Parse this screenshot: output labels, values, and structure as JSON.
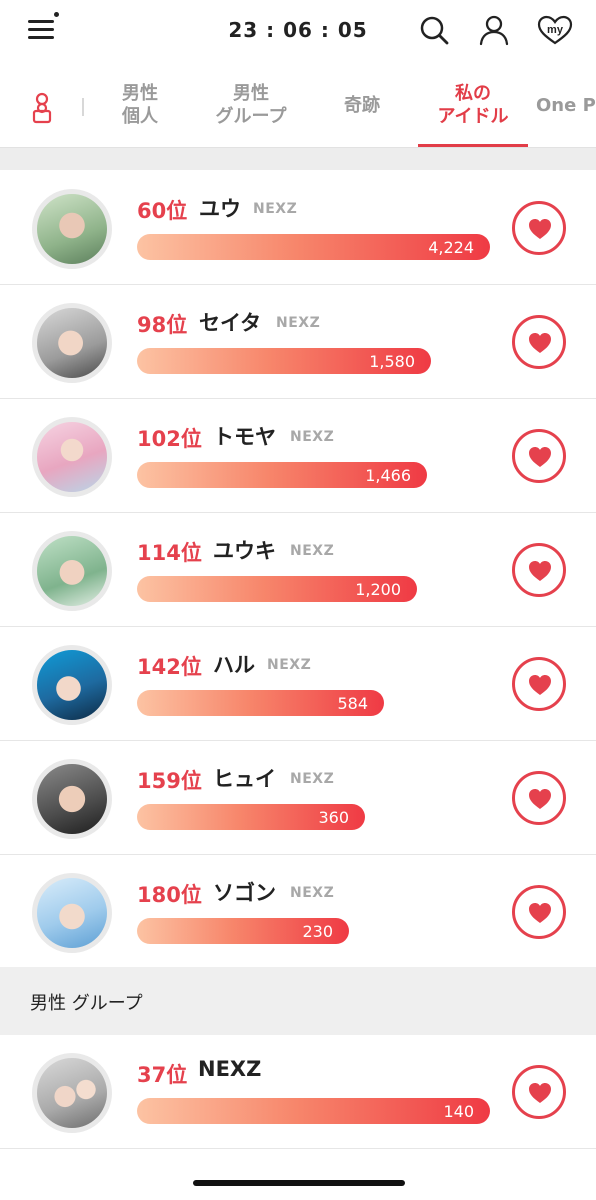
{
  "header": {
    "time": "23 : 06 : 05",
    "icons": [
      "menu-icon",
      "search-icon",
      "user-icon",
      "my-heart-icon"
    ],
    "my_label": "my"
  },
  "tabs": [
    {
      "label": "男性\n個人",
      "active": false
    },
    {
      "label": "男性\nグループ",
      "active": false
    },
    {
      "label": "奇跡",
      "active": false
    },
    {
      "label": "私の\nアイドル",
      "active": true
    },
    {
      "label": "One P",
      "active": false
    }
  ],
  "idols": [
    {
      "rank": "60位",
      "name": "ユウ",
      "group": "NEXZ",
      "votes": "4,224",
      "value": 4224
    },
    {
      "rank": "98位",
      "name": "セイタ",
      "group": "NEXZ",
      "votes": "1,580",
      "value": 1580
    },
    {
      "rank": "102位",
      "name": "トモヤ",
      "group": "NEXZ",
      "votes": "1,466",
      "value": 1466
    },
    {
      "rank": "114位",
      "name": "ユウキ",
      "group": "NEXZ",
      "votes": "1,200",
      "value": 1200
    },
    {
      "rank": "142位",
      "name": "ハル",
      "group": "NEXZ",
      "votes": "584",
      "value": 584
    },
    {
      "rank": "159位",
      "name": "ヒュイ",
      "group": "NEXZ",
      "votes": "360",
      "value": 360
    },
    {
      "rank": "180位",
      "name": "ソゴン",
      "group": "NEXZ",
      "votes": "230",
      "value": 230
    }
  ],
  "group_section": {
    "title": "男性 グループ",
    "entry": {
      "rank": "37位",
      "name": "NEXZ",
      "votes": "140",
      "value": 140
    }
  },
  "colors": {
    "accent": "#e5414d",
    "bar_start": "#fcc3a3",
    "bar_end": "#ef3a44"
  }
}
